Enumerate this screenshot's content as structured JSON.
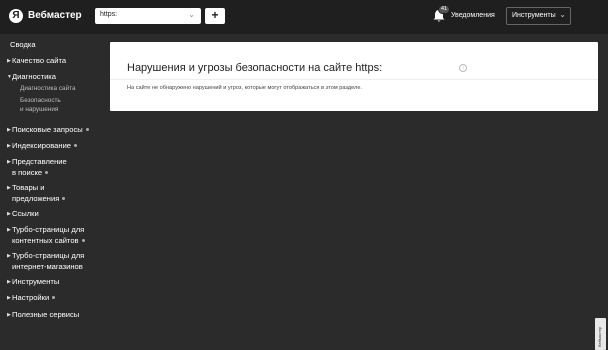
{
  "header": {
    "logo_letter": "Я",
    "brand": "Вебмастер",
    "site_select_value": "https:",
    "add_label": "+",
    "notifications_count": "41",
    "notifications_label": "Уведомления",
    "tools_label": "Инструменты"
  },
  "sidebar": {
    "summary": "Сводка",
    "quality": "Качество сайта",
    "diagnostics": "Диагностика",
    "diag_site": "Диагностика сайта",
    "diag_security_1": "Безопасность",
    "diag_security_2": "и нарушения",
    "search_queries": "Поисковые запросы",
    "indexing": "Индексирование",
    "presentation_1": "Представление",
    "presentation_2": "в поиске",
    "goods_1": "Товары и",
    "goods_2": "предложения",
    "links": "Ссылки",
    "turbo_content_1": "Турбо-страницы для",
    "turbo_content_2": "контентных сайтов",
    "turbo_shops_1": "Турбо-страницы для",
    "turbo_shops_2": "интернет-магазинов",
    "tools": "Инструменты",
    "settings": "Настройки",
    "useful": "Полезные сервисы"
  },
  "main": {
    "title": "Нарушения и угрозы безопасности на сайте https:",
    "info_icon": "i",
    "message": "На сайте не обнаружено нарушений и угроз, которые могут отображаться в этом разделе."
  },
  "side_tab": {
    "label": "Вебмастер"
  },
  "colors": {
    "header_bg": "#1f1f1f",
    "page_bg": "#2b2b2b",
    "card_bg": "#ffffff"
  }
}
